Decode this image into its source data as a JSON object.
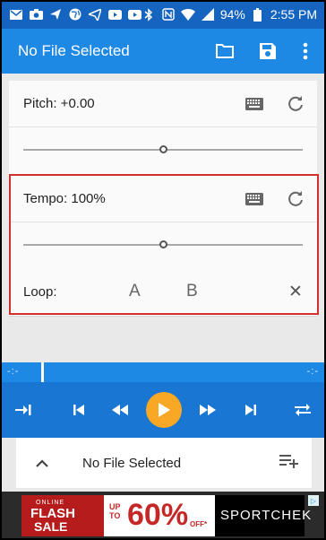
{
  "status_bar": {
    "battery": "94%",
    "time": "2:55 PM",
    "left_icons": [
      "mail-icon",
      "camera-icon",
      "send-icon",
      "globe-icon",
      "paper-plane-icon",
      "youtube-icon",
      "youtube-icon"
    ],
    "right_icons": [
      "bluetooth-icon",
      "nfc-icon",
      "wifi-icon",
      "signal-icon"
    ]
  },
  "app_bar": {
    "title": "No File Selected",
    "actions": [
      "folder-icon",
      "save-icon",
      "more-vert-icon"
    ]
  },
  "pitch": {
    "label": "Pitch: +0.00",
    "slider_fraction": 0.5
  },
  "tempo": {
    "label": "Tempo: 100%",
    "slider_fraction": 0.5
  },
  "loop": {
    "label": "Loop:",
    "point_a": "A",
    "point_b": "B",
    "clear": "✕"
  },
  "progress": {
    "current": "-:-",
    "total": "-:-"
  },
  "transport": {
    "buttons": [
      "skip-to-start-icon",
      "previous-icon",
      "rewind-icon",
      "play-icon",
      "fast-forward-icon",
      "next-icon",
      "repeat-icon"
    ]
  },
  "now_playing": {
    "title": "No File Selected"
  },
  "ad": {
    "online": "ONLINE",
    "flash": "FLASH",
    "sale": "SALE",
    "up_to": "UP TO",
    "percent": "60%",
    "off": "OFF*",
    "brand": "SPORTCHEK"
  },
  "colors": {
    "primary": "#1e88e5",
    "primary_dark": "#1565c0",
    "accent": "#f9a825",
    "highlight": "#d32f2f"
  }
}
